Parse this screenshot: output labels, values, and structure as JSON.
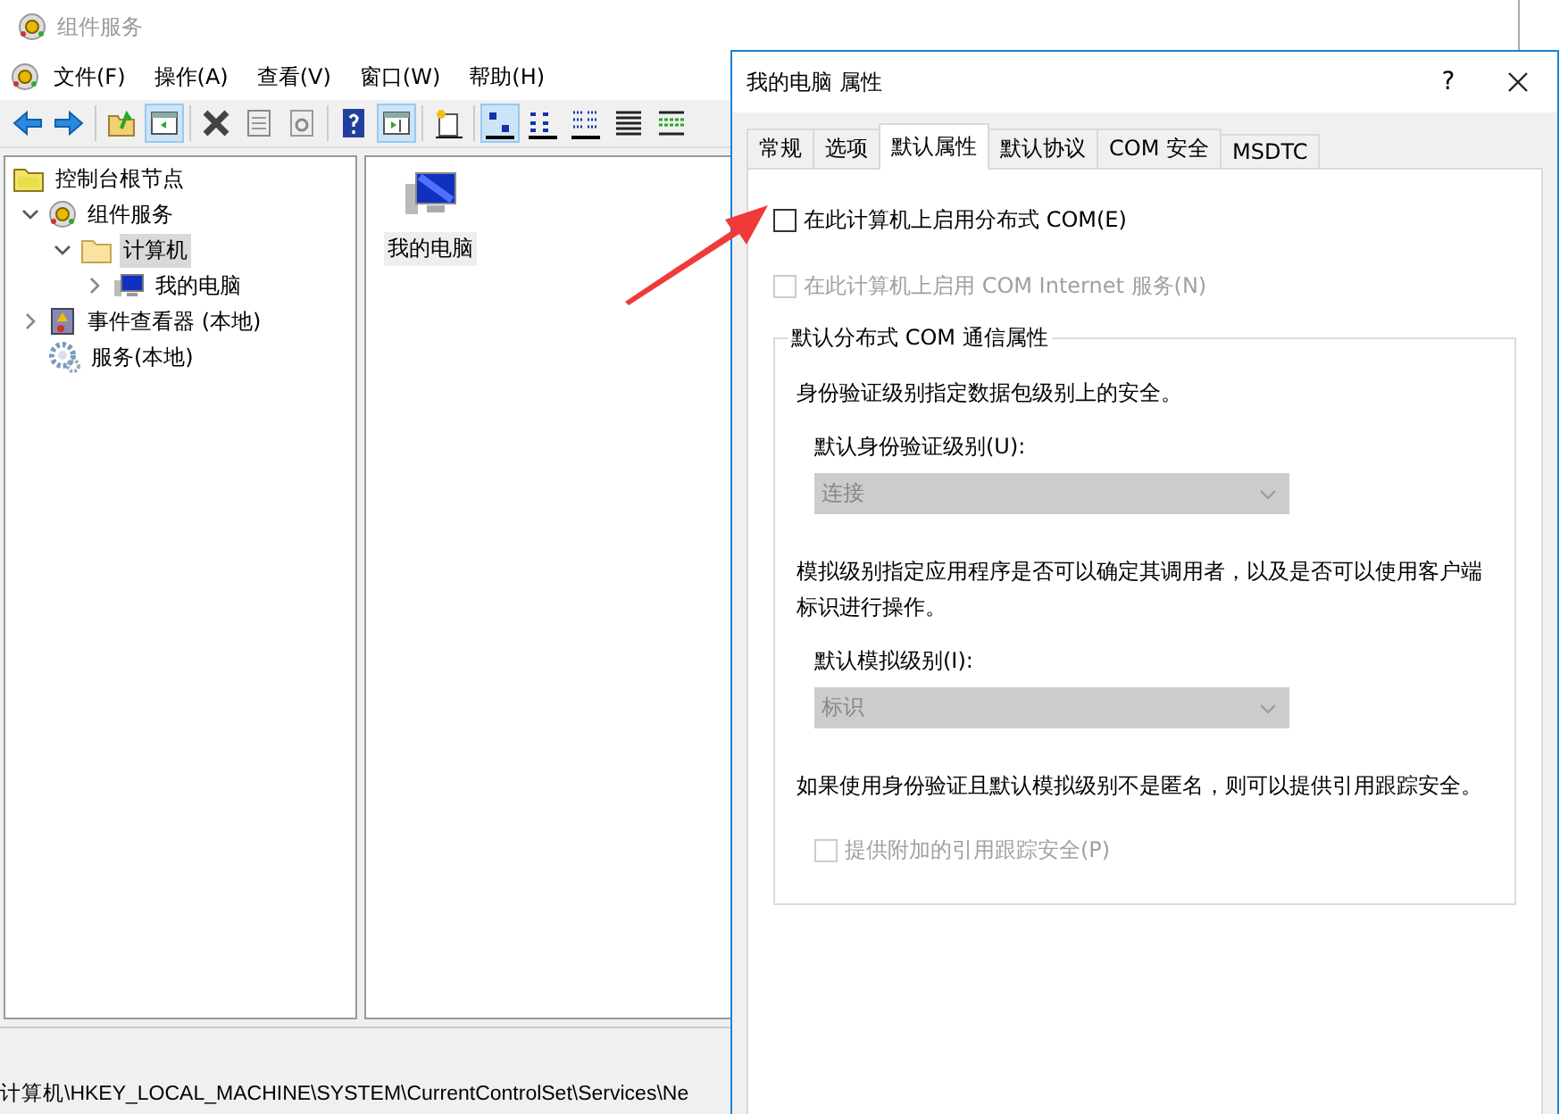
{
  "main_window": {
    "title": "组件服务",
    "menu": [
      "文件(F)",
      "操作(A)",
      "查看(V)",
      "窗口(W)",
      "帮助(H)"
    ],
    "toolbar": [
      {
        "kind": "back",
        "pressed": false
      },
      {
        "kind": "forward",
        "pressed": false
      },
      {
        "kind": "sep"
      },
      {
        "kind": "up",
        "pressed": false
      },
      {
        "kind": "tree",
        "pressed": true
      },
      {
        "kind": "sep"
      },
      {
        "kind": "delete",
        "pressed": false
      },
      {
        "kind": "properties",
        "pressed": false
      },
      {
        "kind": "refresh",
        "pressed": false
      },
      {
        "kind": "sep"
      },
      {
        "kind": "help",
        "pressed": false
      },
      {
        "kind": "actionpane",
        "pressed": true
      },
      {
        "kind": "sep"
      },
      {
        "kind": "new",
        "pressed": false
      },
      {
        "kind": "sep"
      },
      {
        "kind": "largeicons",
        "pressed": true
      },
      {
        "kind": "smallicons",
        "pressed": false
      },
      {
        "kind": "list",
        "pressed": false
      },
      {
        "kind": "details",
        "pressed": false
      },
      {
        "kind": "detailsgreen",
        "pressed": false
      }
    ],
    "tree": [
      {
        "label": "控制台根节点",
        "kind": "folderyellow",
        "selected": false,
        "children": [
          {
            "label": "组件服务",
            "kind": "gear",
            "selected": false,
            "expanded": true,
            "children": [
              {
                "label": "计算机",
                "kind": "folder",
                "selected": true,
                "expanded": true,
                "children": [
                  {
                    "label": "我的电脑",
                    "kind": "computer",
                    "selected": false,
                    "expanded": false
                  }
                ]
              }
            ]
          },
          {
            "label": "事件查看器 (本地)",
            "kind": "log",
            "selected": false,
            "expanded": false
          },
          {
            "label": "服务(本地)",
            "kind": "cog",
            "selected": false
          }
        ]
      }
    ],
    "items": [
      {
        "label": "我的电脑",
        "selected": true
      }
    ],
    "status_bar": "计算机\\HKEY_LOCAL_MACHINE\\SYSTEM\\CurrentControlSet\\Services\\Ne"
  },
  "dialog": {
    "title": "我的电脑 属性",
    "help": "?",
    "tabs": [
      {
        "label": "常规",
        "selected": false
      },
      {
        "label": "选项",
        "selected": false
      },
      {
        "label": "默认属性",
        "selected": true
      },
      {
        "label": "默认协议",
        "selected": false
      },
      {
        "label": "COM 安全",
        "selected": false
      },
      {
        "label": "MSDTC",
        "selected": false
      }
    ],
    "options": [
      {
        "label": "在此计算机上启用分布式 COM(E)",
        "checked": false,
        "disabled": false
      },
      {
        "label": "在此计算机上启用 COM Internet 服务(N)",
        "checked": false,
        "disabled": true
      }
    ],
    "group": {
      "title": "默认分布式 COM 通信属性",
      "items": [
        {
          "kind": "text",
          "text": "身份验证级别指定数据包级别上的安全。"
        },
        {
          "kind": "combo",
          "label": "默认身份验证级别(U):",
          "value": "连接",
          "disabled": true
        },
        {
          "kind": "text",
          "text": "模拟级别指定应用程序是否可以确定其调用者，以及是否可以使用客户端标识进行操作。"
        },
        {
          "kind": "combo",
          "label": "默认模拟级别(I):",
          "value": "标识",
          "disabled": true
        },
        {
          "kind": "text",
          "text": "如果使用身份验证且默认模拟级别不是匿名，则可以提供引用跟踪安全。"
        },
        {
          "kind": "checkbox",
          "label": "提供附加的引用跟踪安全(P)",
          "checked": false,
          "disabled": true
        }
      ]
    }
  },
  "annotation": {
    "kind": "arrow"
  }
}
